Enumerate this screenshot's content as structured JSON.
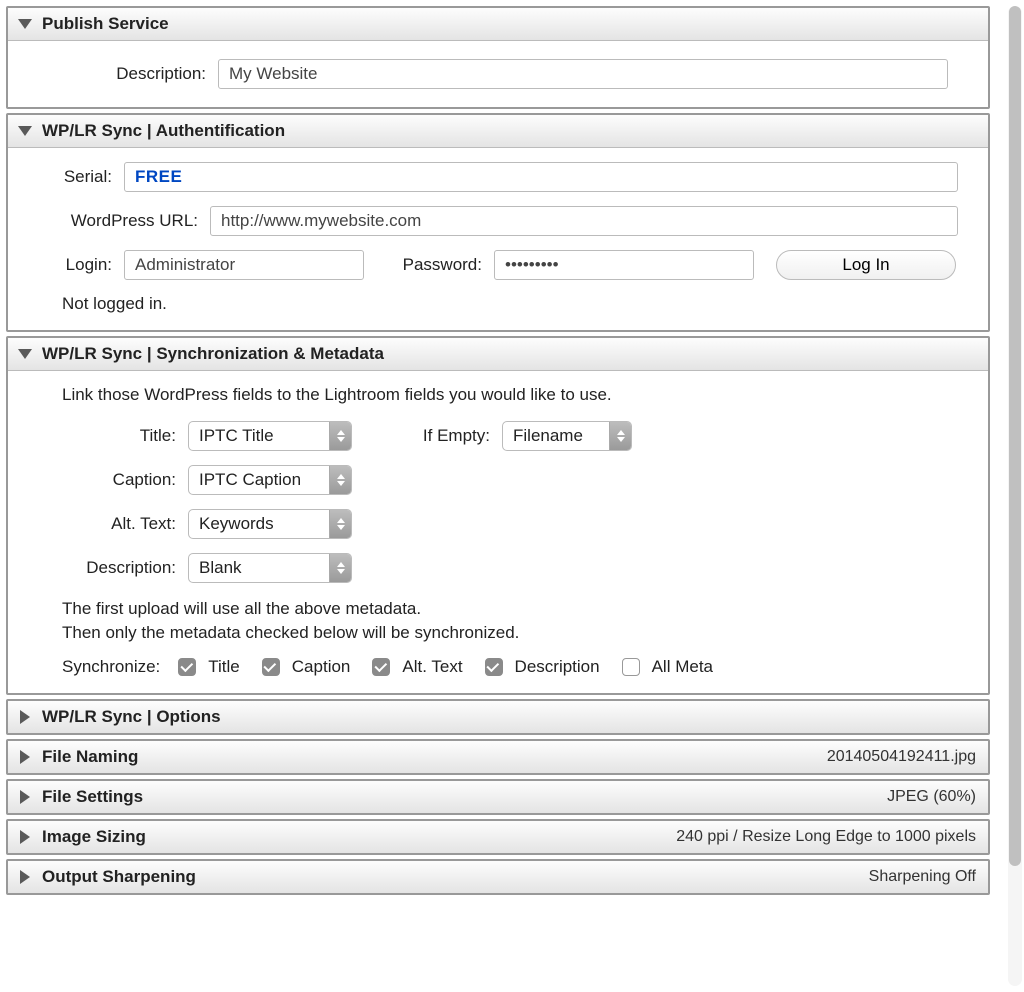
{
  "panels": {
    "publish": {
      "title": "Publish Service",
      "fields": {
        "description_label": "Description:",
        "description_value": "My Website"
      }
    },
    "auth": {
      "title": "WP/LR Sync | Authentification",
      "fields": {
        "serial_label": "Serial:",
        "serial_value": "FREE",
        "url_label": "WordPress URL:",
        "url_value": "http://www.mywebsite.com",
        "login_label": "Login:",
        "login_value": "Administrator",
        "password_label": "Password:",
        "password_value": "•••••••••",
        "login_button": "Log In",
        "status": "Not logged in."
      }
    },
    "sync": {
      "title": "WP/LR Sync | Synchronization & Metadata",
      "intro": "Link those WordPress fields to the Lightroom fields you would like to use.",
      "rows": {
        "title_label": "Title:",
        "title_value": "IPTC Title",
        "ifempty_label": "If Empty:",
        "ifempty_value": "Filename",
        "caption_label": "Caption:",
        "caption_value": "IPTC Caption",
        "alt_label": "Alt. Text:",
        "alt_value": "Keywords",
        "desc_label": "Description:",
        "desc_value": "Blank"
      },
      "note_line1": "The first upload will use all the above metadata.",
      "note_line2": "Then only the metadata checked below will be synchronized.",
      "sync_label": "Synchronize:",
      "checks": {
        "title": "Title",
        "caption": "Caption",
        "alt": "Alt. Text",
        "desc": "Description",
        "all": "All Meta"
      }
    },
    "options": {
      "title": "WP/LR Sync | Options"
    },
    "filenaming": {
      "title": "File Naming",
      "status": "20140504192411.jpg"
    },
    "filesettings": {
      "title": "File Settings",
      "status": "JPEG (60%)"
    },
    "imagesizing": {
      "title": "Image Sizing",
      "status": "240 ppi / Resize Long Edge to 1000 pixels"
    },
    "sharpening": {
      "title": "Output Sharpening",
      "status": "Sharpening Off"
    }
  }
}
